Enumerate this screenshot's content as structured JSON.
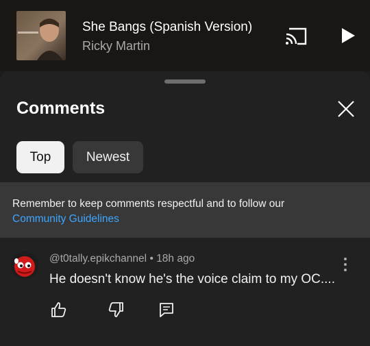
{
  "player": {
    "title": "She Bangs (Spanish Version)",
    "artist": "Ricky Martin",
    "cast_icon": "cast-icon",
    "play_icon": "play-icon"
  },
  "comments_panel": {
    "title": "Comments",
    "close_icon": "close-icon",
    "sort_chips": [
      {
        "label": "Top",
        "selected": true
      },
      {
        "label": "Newest",
        "selected": false
      }
    ],
    "notice": {
      "text": "Remember to keep comments respectful and to follow our",
      "link": "Community Guidelines"
    },
    "comments": [
      {
        "author": "@t0tally.epikchannel",
        "separator": "•",
        "time": "18h ago",
        "text": "He doesn't know he's the voice claim to my OC....",
        "actions": [
          "like-icon",
          "dislike-icon",
          "reply-icon"
        ]
      }
    ]
  },
  "colors": {
    "player_bg": "#1a1613",
    "sheet_bg": "#212121",
    "notice_bg": "#383838",
    "link": "#3ea6ff",
    "chip_selected_bg": "#f1f1f1",
    "chip_bg": "#383838"
  }
}
